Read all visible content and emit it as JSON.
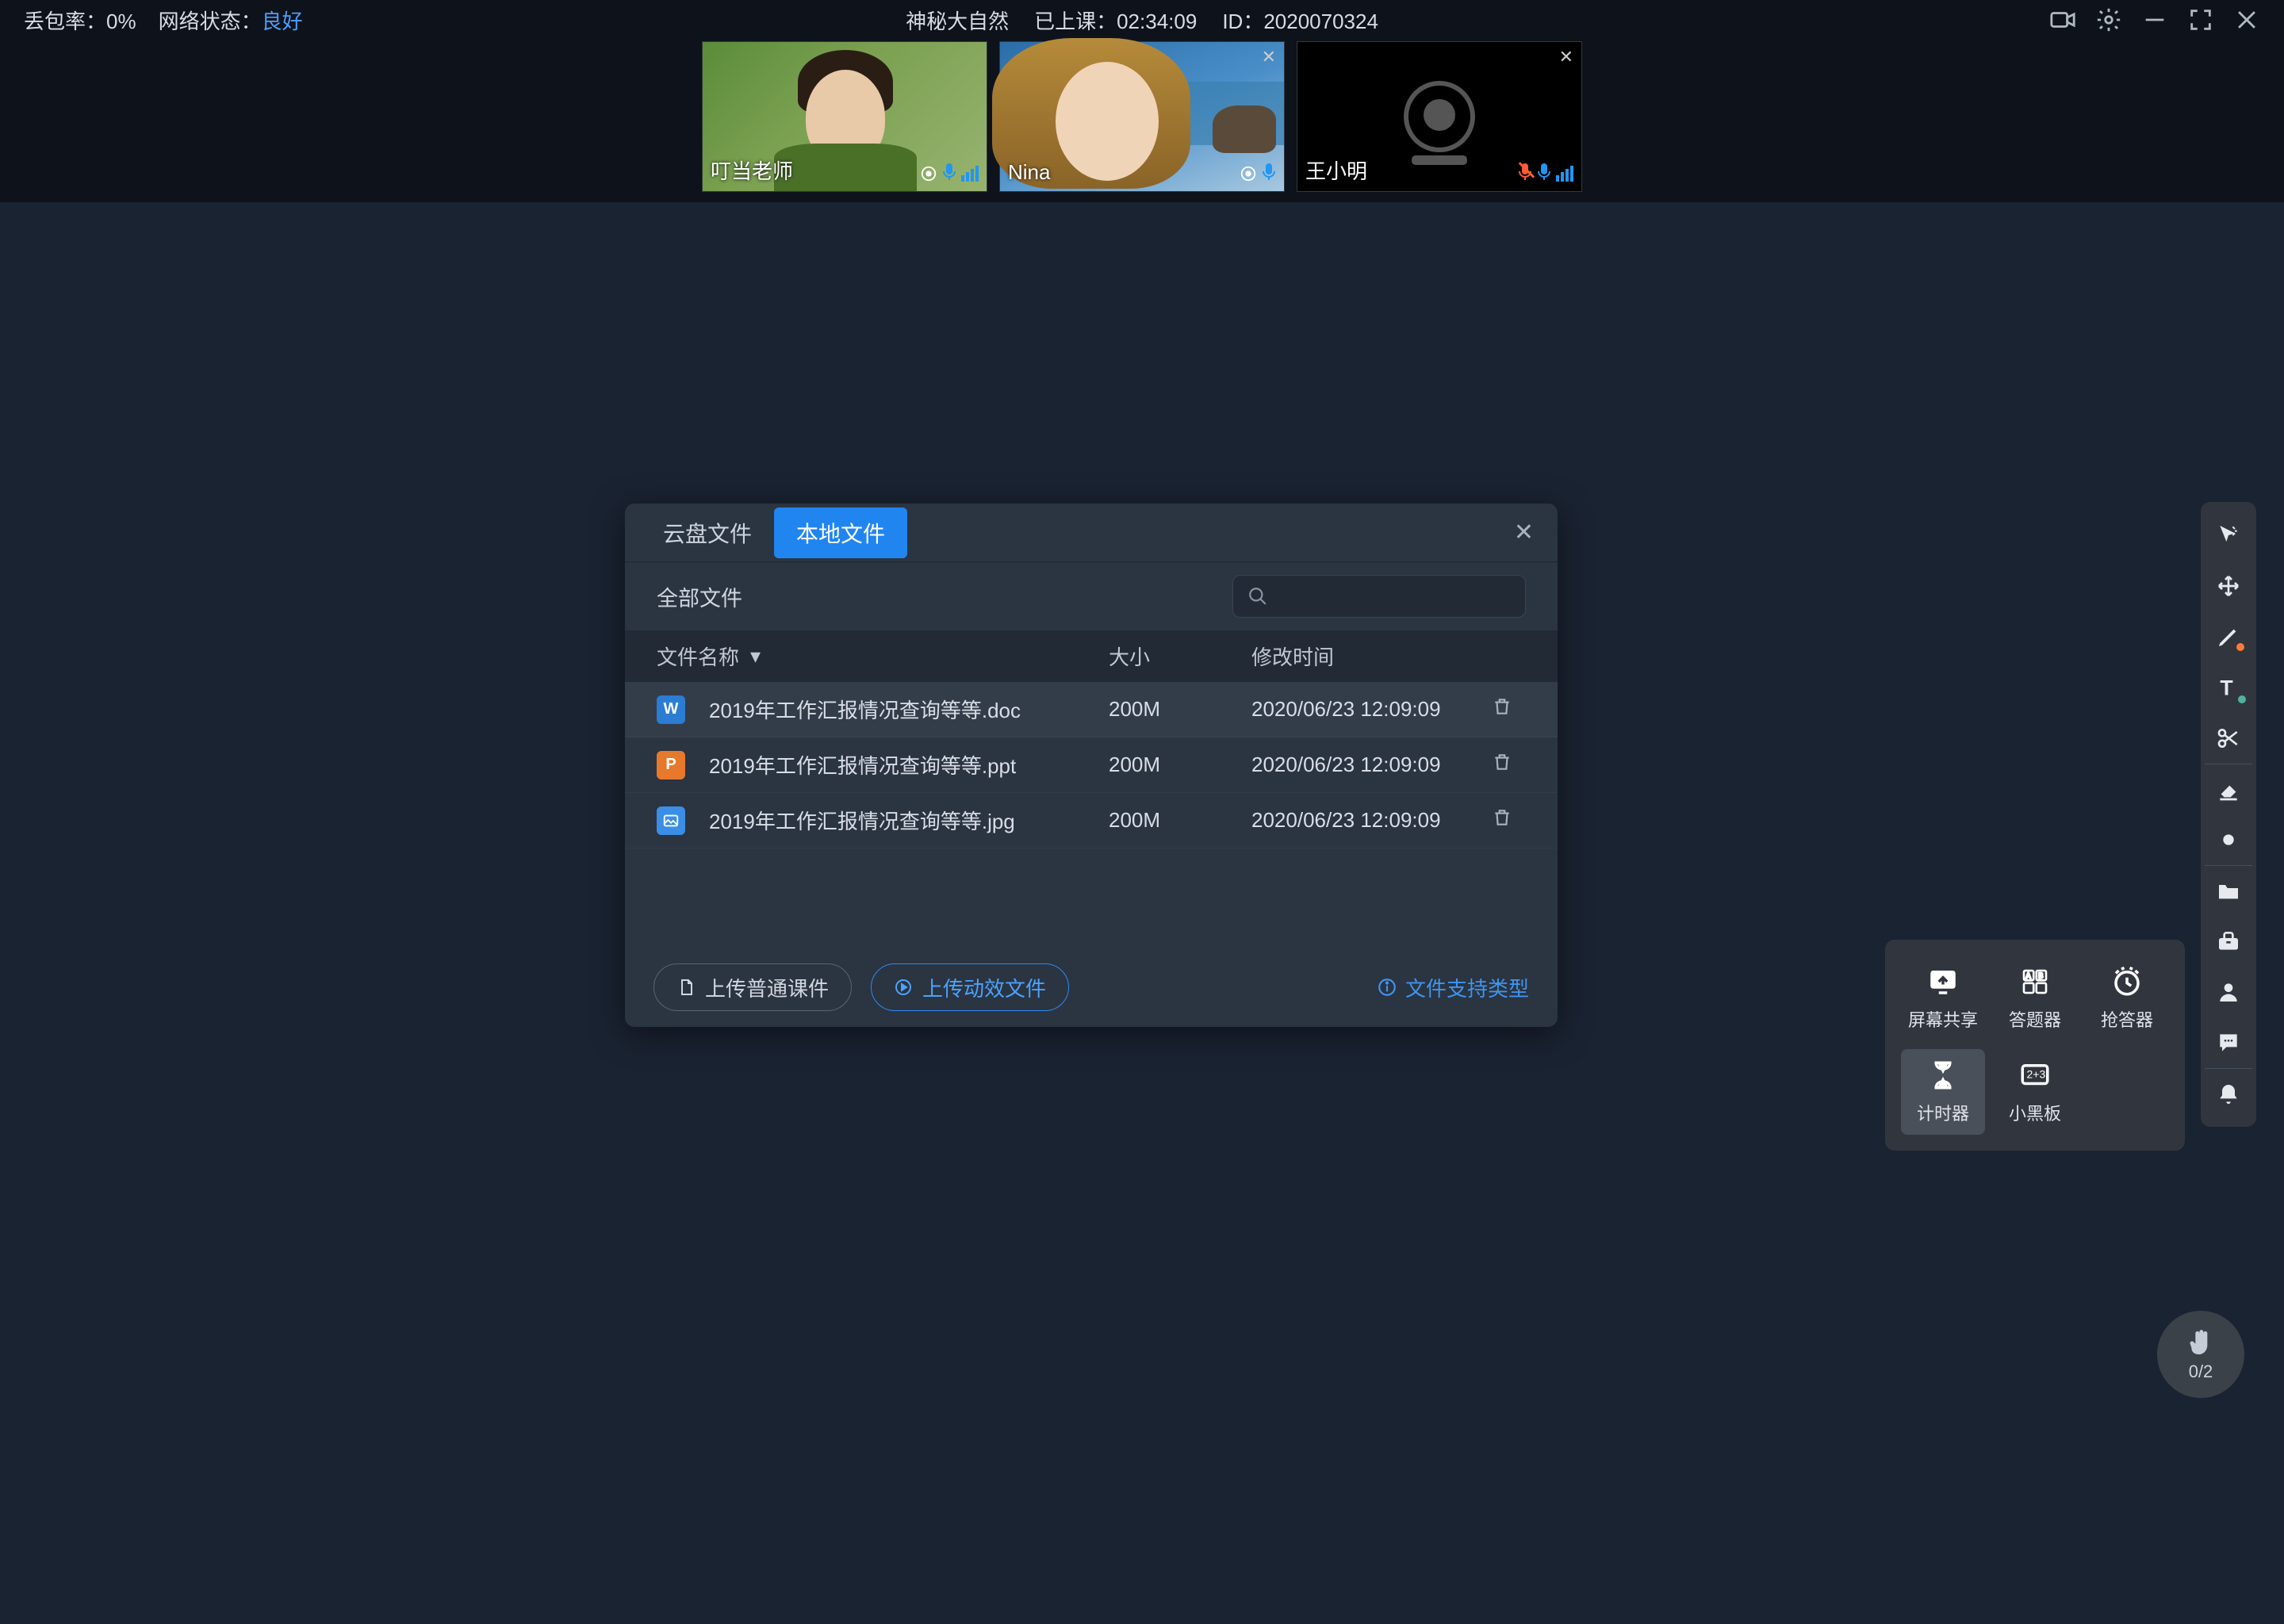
{
  "topbar": {
    "packet_loss_label": "丢包率：",
    "packet_loss_value": "0%",
    "net_status_label": "网络状态：",
    "net_status_value": "良好",
    "title": "神秘大自然",
    "elapsed_label": "已上课：",
    "elapsed_value": "02:34:09",
    "id_label": "ID：",
    "id_value": "2020070324"
  },
  "participants": [
    {
      "name": "叮当老师",
      "closable": false,
      "mic_muted": false
    },
    {
      "name": "Nina",
      "closable": true,
      "mic_muted": false
    },
    {
      "name": "王小明",
      "closable": true,
      "mic_muted": true
    }
  ],
  "file_panel": {
    "tabs": [
      "云盘文件",
      "本地文件"
    ],
    "active_tab": 1,
    "filter_label": "全部文件",
    "columns": {
      "name": "文件名称",
      "size": "大小",
      "time": "修改时间"
    },
    "rows": [
      {
        "icon": "W",
        "name": "2019年工作汇报情况查询等等.doc",
        "size": "200M",
        "time": "2020/06/23 12:09:09"
      },
      {
        "icon": "P",
        "name": "2019年工作汇报情况查询等等.ppt",
        "size": "200M",
        "time": "2020/06/23 12:09:09"
      },
      {
        "icon": "img",
        "name": "2019年工作汇报情况查询等等.jpg",
        "size": "200M",
        "time": "2020/06/23 12:09:09"
      }
    ],
    "upload_normal": "上传普通课件",
    "upload_dynamic": "上传动效文件",
    "support_link": "文件支持类型"
  },
  "tool_popup": {
    "items": [
      "屏幕共享",
      "答题器",
      "抢答器",
      "计时器",
      "小黑板"
    ],
    "active": 3
  },
  "hand": {
    "count": "0/2"
  }
}
